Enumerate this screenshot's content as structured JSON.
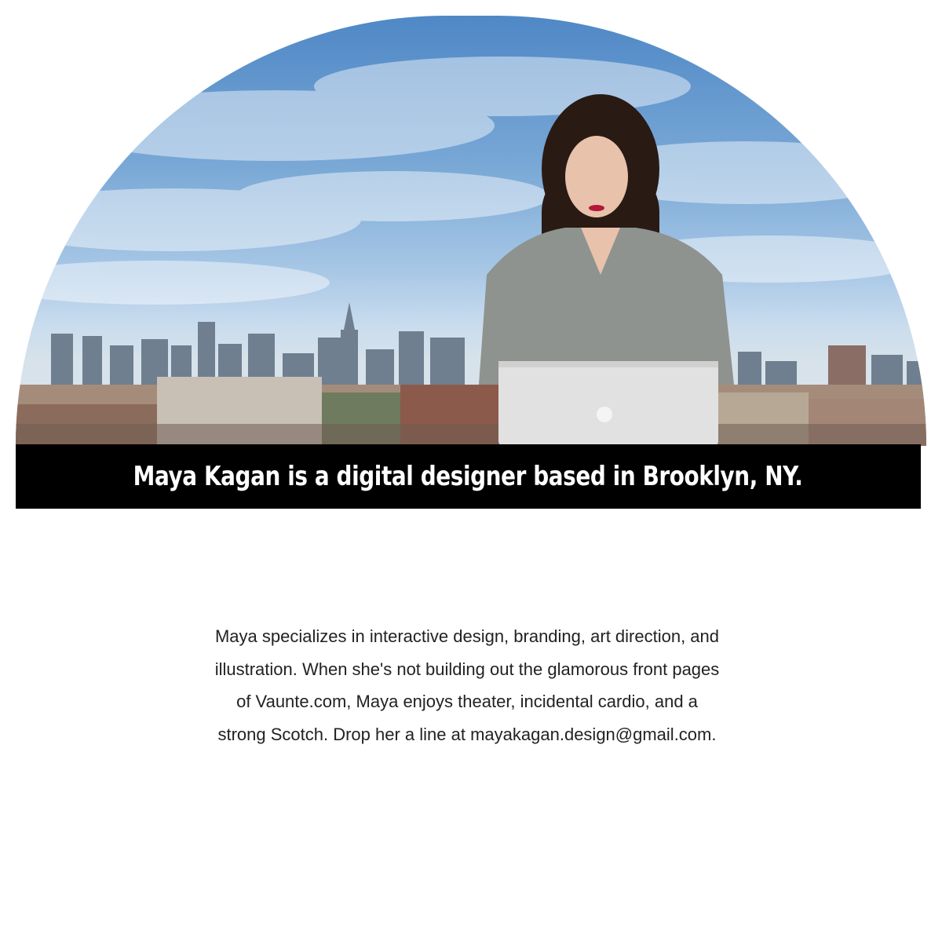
{
  "hero": {
    "tagline": "Maya Kagan is a digital designer based in Brooklyn, NY.",
    "photo_subject": "woman working on a laptop on a rooftop with city skyline",
    "colors": {
      "sky": "#79a8d6",
      "caption_bar": "#000000",
      "caption_text": "#ffffff"
    }
  },
  "bio": {
    "text_before_link": "Maya specializes in interactive design, branding, art direction, and illustration. When she's not building out the glamorous front pages of Vaunte.com, Maya enjoys theater, incidental cardio, and a strong Scotch. Drop her a line at ",
    "email": "mayakagan.design@gmail.com",
    "text_after_link": "."
  }
}
